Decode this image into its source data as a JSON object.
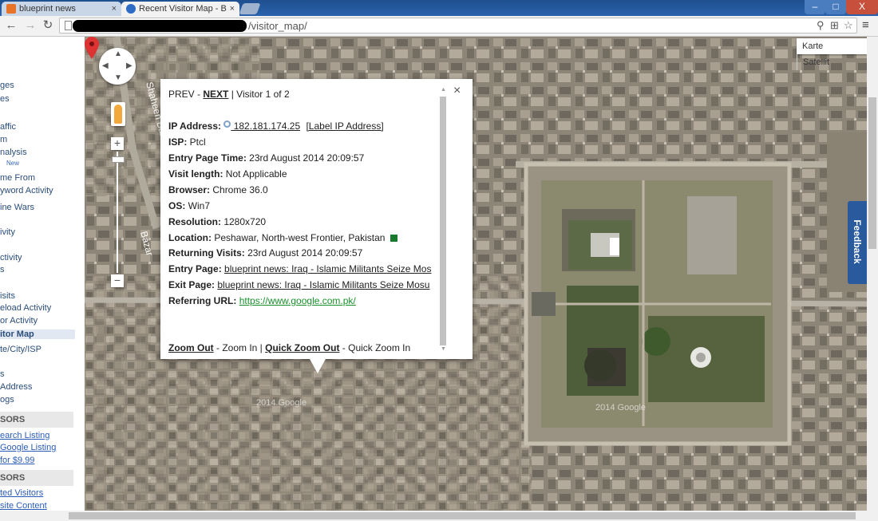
{
  "browser": {
    "tabs": [
      {
        "label": "blueprint news",
        "close": "×"
      },
      {
        "label": "Recent Visitor Map - B",
        "close": "×"
      }
    ],
    "url": "/visitor_map/",
    "window_controls": {
      "minimize": "–",
      "maximize": "□",
      "close": "X"
    },
    "nav": {
      "back": "←",
      "forward": "→",
      "reload": "↻",
      "menu": "≡"
    },
    "omni_icons": {
      "zoom": "⚲",
      "translate": "⊞",
      "star": "☆"
    }
  },
  "sidebar": {
    "items": [
      {
        "label": "ges"
      },
      {
        "label": "es"
      },
      {
        "label": "affic"
      },
      {
        "label": "m"
      },
      {
        "label": "nalysis"
      },
      {
        "label": "me From"
      },
      {
        "label": "yword Activity"
      },
      {
        "label": "ine Wars"
      },
      {
        "label": "ivity"
      },
      {
        "label": "ctivity"
      },
      {
        "label": "s"
      },
      {
        "label": "isits"
      },
      {
        "label": "eload Activity"
      },
      {
        "label": "or Activity"
      },
      {
        "label": "itor Map"
      },
      {
        "label": "te/City/ISP"
      },
      {
        "label": "s"
      },
      {
        "label": "Address"
      },
      {
        "label": "ogs"
      }
    ],
    "new_badge": "New",
    "section1_header": "SORS",
    "section1_links": [
      "earch Listing",
      "Google Listing",
      " for $9.99"
    ],
    "section2_header": "SORS",
    "section2_links": [
      "ted Visitors",
      "site Content"
    ]
  },
  "map": {
    "map_type": {
      "map": "Karte",
      "satellite": "Satellit"
    },
    "feedback": "Feedback",
    "zoom_in": "+",
    "zoom_out": "−",
    "labels": [
      "Shaheen Bazar",
      "Bazar"
    ],
    "watermark": "2014 Google"
  },
  "infowindow": {
    "prev": "PREV",
    "sep1": " - ",
    "next": "NEXT",
    "counter": " | Visitor 1 of 2",
    "close": "×",
    "ip_label": "IP Address:",
    "ip_value": " 182.181.174.25",
    "ip_action": "[Label IP Address]",
    "isp_label": "ISP:",
    "isp_value": " Ptcl",
    "entry_time_label": "Entry Page Time:",
    "entry_time_value": " 23rd August 2014 20:09:57",
    "visit_length_label": "Visit length:",
    "visit_length_value": " Not Applicable",
    "browser_label": "Browser:",
    "browser_value": " Chrome 36.0",
    "os_label": "OS:",
    "os_value": " Win7",
    "resolution_label": "Resolution:",
    "resolution_value": " 1280x720",
    "location_label": "Location:",
    "location_value": " Peshawar, North-west Frontier, Pakistan ",
    "returning_label": "Returning Visits:",
    "returning_value": " 23rd August 2014 20:09:57",
    "entry_page_label": "Entry Page:",
    "entry_page_value": "blueprint news: Iraq - Islamic Militants Seize Mos",
    "exit_page_label": "Exit Page:",
    "exit_page_value": "blueprint news: Iraq - Islamic Militants Seize Mosu",
    "referring_label": "Referring URL:",
    "referring_value": "https://www.google.com.pk/",
    "zoom_out": "Zoom Out",
    "zoom_in_text": " - Zoom In | ",
    "quick_zoom_out": "Quick Zoom Out",
    "quick_zoom_in_text": " - Quick Zoom In"
  },
  "colors": {
    "link": "#2a5cb8",
    "referrer": "#1a8f2c",
    "feedback_bg": "#2a5a9e",
    "marker": "#d33"
  }
}
